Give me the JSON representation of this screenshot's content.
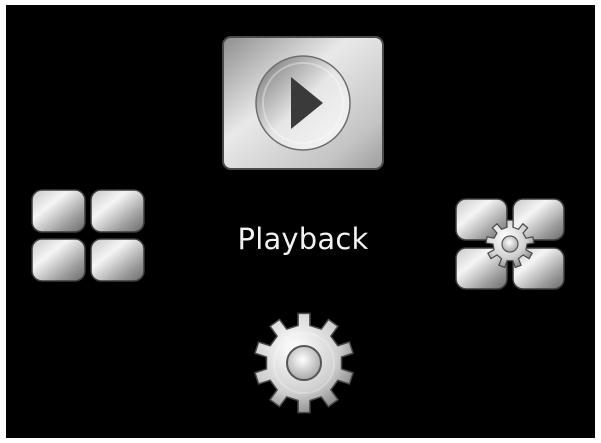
{
  "menu": {
    "selected_label": "Playback",
    "items": [
      {
        "id": "playback",
        "icon": "play-icon",
        "selected": true
      },
      {
        "id": "multiview",
        "icon": "grid-icon"
      },
      {
        "id": "setup",
        "icon": "grid-gear-icon"
      },
      {
        "id": "settings",
        "icon": "gear-icon"
      }
    ]
  },
  "colors": {
    "background": "#000000",
    "label": "#f2f2f2",
    "metal_light": "#f4f4f4",
    "metal_dark": "#555555"
  }
}
